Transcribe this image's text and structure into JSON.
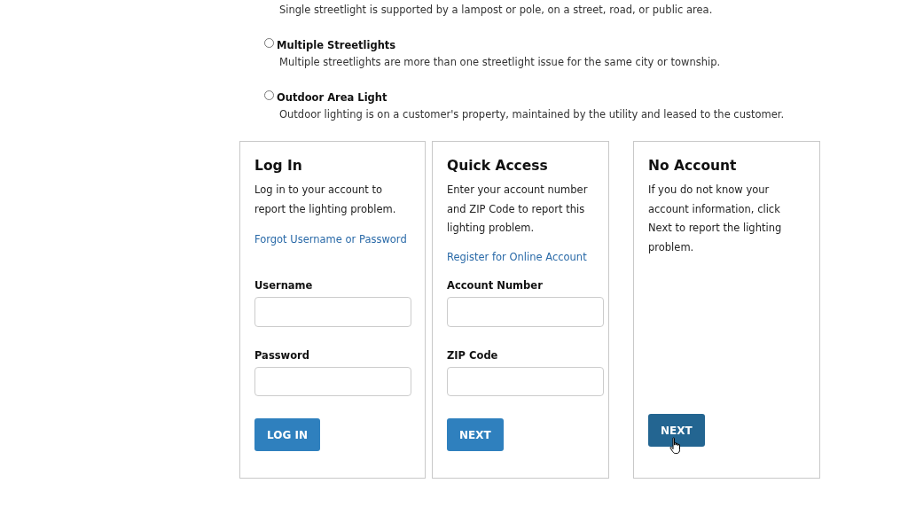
{
  "options": [
    {
      "description": "Single streetlight is supported by a lampost or pole, on a street, road, or public area."
    },
    {
      "title": "Multiple Streetlights",
      "selected": false,
      "description": "Multiple streetlights are more than one streetlight issue for the same city or township."
    },
    {
      "title": "Outdoor Area Light",
      "selected": false,
      "description": "Outdoor lighting is on a customer's property, maintained by the utility and leased to the customer."
    }
  ],
  "cards": [
    {
      "title": "Log In",
      "text": "Log in to your account to report the lighting problem.",
      "link": "Forgot Username or Password",
      "fields": [
        {
          "label": "Username"
        },
        {
          "label": "Password"
        }
      ],
      "button": {
        "label": "LOG IN",
        "hovered": false
      }
    },
    {
      "title": "Quick Access",
      "text": "Enter your account number and ZIP Code to report this lighting problem.",
      "link": "Register for Online Account",
      "fields": [
        {
          "label": "Account Number"
        },
        {
          "label": "ZIP Code"
        }
      ],
      "button": {
        "label": "NEXT",
        "hovered": false
      }
    },
    {
      "title": "No Account",
      "text": "If you do not know your account information, click Next to report the lighting problem.",
      "button": {
        "label": "NEXT",
        "hovered": true
      }
    }
  ]
}
